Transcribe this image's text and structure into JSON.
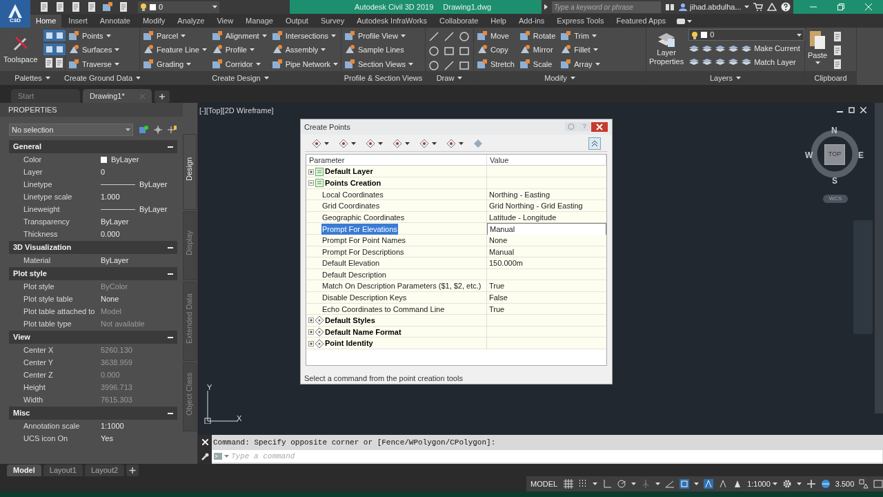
{
  "title_bar": {
    "layer": "0",
    "app_title": "Autodesk Civil 3D 2019",
    "file_name": "Drawing1.dwg",
    "search": {
      "placeholder": "Type a keyword or phrase"
    },
    "user": "jihad.abdulha..."
  },
  "app_button": {
    "label": "C3D"
  },
  "ribbon_tabs": [
    {
      "label": "Home",
      "selected": true
    },
    {
      "label": "Insert",
      "selected": false
    },
    {
      "label": "Annotate",
      "selected": false
    },
    {
      "label": "Modify",
      "selected": false
    },
    {
      "label": "Analyze",
      "selected": false
    },
    {
      "label": "View",
      "selected": false
    },
    {
      "label": "Manage",
      "selected": false
    },
    {
      "label": "Output",
      "selected": false
    },
    {
      "label": "Survey",
      "selected": false
    },
    {
      "label": "Autodesk InfraWorks",
      "selected": false
    },
    {
      "label": "Collaborate",
      "selected": false
    },
    {
      "label": "Help",
      "selected": false
    },
    {
      "label": "Add-ins",
      "selected": false
    },
    {
      "label": "Express Tools",
      "selected": false
    },
    {
      "label": "Featured Apps",
      "selected": false
    }
  ],
  "ribbon_panels": [
    {
      "kind": "palettes",
      "title": "Palettes",
      "dropdown": true,
      "big_button": "Toolspace"
    },
    {
      "kind": "columns",
      "title": "Create Ground Data",
      "dropdown": true,
      "columns": [
        [
          {
            "label": "Points",
            "dropdown": true
          },
          {
            "label": "Surfaces",
            "dropdown": true
          },
          {
            "label": "Traverse",
            "dropdown": true
          }
        ]
      ]
    },
    {
      "kind": "columns",
      "title": "Create Design",
      "dropdown": true,
      "columns": [
        [
          {
            "label": "Parcel",
            "dropdown": true
          },
          {
            "label": "Feature Line",
            "dropdown": true
          },
          {
            "label": "Grading",
            "dropdown": true
          }
        ],
        [
          {
            "label": "Alignment",
            "dropdown": true
          },
          {
            "label": "Profile",
            "dropdown": true
          },
          {
            "label": "Corridor",
            "dropdown": true
          }
        ],
        [
          {
            "label": "Intersections",
            "dropdown": true
          },
          {
            "label": "Assembly",
            "dropdown": true
          },
          {
            "label": "Pipe Network",
            "dropdown": true
          }
        ]
      ]
    },
    {
      "kind": "columns",
      "title": "Profile & Section Views",
      "dropdown": false,
      "columns": [
        [
          {
            "label": "Profile View",
            "dropdown": true
          },
          {
            "label": "Sample Lines",
            "dropdown": false
          },
          {
            "label": "Section Views",
            "dropdown": true
          }
        ]
      ]
    },
    {
      "kind": "icons",
      "title": "Draw",
      "dropdown": true
    },
    {
      "kind": "columns",
      "title": "Modify",
      "dropdown": true,
      "columns": [
        [
          {
            "label": "Move",
            "dropdown": false
          },
          {
            "label": "Copy",
            "dropdown": false
          },
          {
            "label": "Stretch",
            "dropdown": false
          }
        ],
        [
          {
            "label": "Rotate",
            "dropdown": false
          },
          {
            "label": "Mirror",
            "dropdown": false
          },
          {
            "label": "Scale",
            "dropdown": false
          }
        ],
        [
          {
            "label": "Trim",
            "dropdown": true
          },
          {
            "label": "Fillet",
            "dropdown": true
          },
          {
            "label": "Array",
            "dropdown": true
          }
        ]
      ]
    },
    {
      "kind": "layers",
      "title": "Layers",
      "dropdown": true,
      "big_button": "Layer Properties",
      "layer": "0",
      "items": [
        {
          "label": "Make Current"
        },
        {
          "label": "Match Layer"
        }
      ]
    },
    {
      "kind": "clipboard",
      "title": "Clipboard",
      "dropdown": false,
      "big_button": "Paste"
    }
  ],
  "document_tabs": [
    {
      "label": "Start",
      "selected": false
    },
    {
      "label": "Drawing1*",
      "selected": true
    }
  ],
  "properties": {
    "title": "PROPERTIES",
    "selection": "No selection",
    "sections": [
      {
        "title": "General",
        "expanded": true,
        "rows": [
          {
            "kind": "color",
            "label": "Color",
            "value": "ByLayer",
            "disabled": false
          },
          {
            "kind": "text",
            "label": "Layer",
            "value": "0",
            "disabled": false
          },
          {
            "kind": "line",
            "label": "Linetype",
            "value": "ByLayer",
            "disabled": false
          },
          {
            "kind": "text",
            "label": "Linetype scale",
            "value": "1.000",
            "disabled": false
          },
          {
            "kind": "line",
            "label": "Lineweight",
            "value": "ByLayer",
            "disabled": false
          },
          {
            "kind": "text",
            "label": "Transparency",
            "value": "ByLayer",
            "disabled": false
          },
          {
            "kind": "text",
            "label": "Thickness",
            "value": "0.000",
            "disabled": false
          }
        ]
      },
      {
        "title": "3D Visualization",
        "expanded": true,
        "rows": [
          {
            "kind": "text",
            "label": "Material",
            "value": "ByLayer",
            "disabled": false
          }
        ]
      },
      {
        "title": "Plot style",
        "expanded": true,
        "rows": [
          {
            "kind": "text",
            "label": "Plot style",
            "value": "ByColor",
            "disabled": true
          },
          {
            "kind": "text",
            "label": "Plot style table",
            "value": "None",
            "disabled": false
          },
          {
            "kind": "text",
            "label": "Plot table attached to",
            "value": "Model",
            "disabled": true
          },
          {
            "kind": "text",
            "label": "Plot table type",
            "value": "Not available",
            "disabled": true
          }
        ]
      },
      {
        "title": "View",
        "expanded": true,
        "rows": [
          {
            "kind": "text",
            "label": "Center X",
            "value": "5260.130",
            "disabled": true
          },
          {
            "kind": "text",
            "label": "Center Y",
            "value": "3638.959",
            "disabled": true
          },
          {
            "kind": "text",
            "label": "Center Z",
            "value": "0.000",
            "disabled": true
          },
          {
            "kind": "text",
            "label": "Height",
            "value": "3996.713",
            "disabled": true
          },
          {
            "kind": "text",
            "label": "Width",
            "value": "7615.303",
            "disabled": true
          }
        ]
      },
      {
        "title": "Misc",
        "expanded": true,
        "rows": [
          {
            "kind": "text",
            "label": "Annotation scale",
            "value": "1:1000",
            "disabled": false
          },
          {
            "kind": "text",
            "label": "UCS icon On",
            "value": "Yes",
            "disabled": false
          }
        ]
      }
    ],
    "side_tabs": [
      {
        "label": "Design",
        "selected": true
      },
      {
        "label": "Display",
        "selected": false
      },
      {
        "label": "Extended Data",
        "selected": false
      },
      {
        "label": "Object Class",
        "selected": false
      }
    ]
  },
  "viewport": {
    "label": "[-][Top][2D Wireframe]",
    "viewcube": {
      "north": "N",
      "south": "S",
      "west": "W",
      "east": "E",
      "face": "TOP",
      "ucs": "WCS"
    },
    "ucs_icon": {
      "y": "Y",
      "x": "X"
    }
  },
  "dialog": {
    "title": "Create Points",
    "columns": [
      "Parameter",
      "Value"
    ],
    "rows": [
      {
        "kind": "group",
        "label": "Default Layer",
        "expanded": false
      },
      {
        "kind": "group",
        "label": "Points Creation",
        "expanded": true,
        "children": [
          {
            "label": "Local Coordinates",
            "value": "Northing - Easting",
            "selected": false
          },
          {
            "label": "Grid Coordinates",
            "value": "Grid Northing - Grid Easting",
            "selected": false
          },
          {
            "label": "Geographic Coordinates",
            "value": "Latitude - Longitude",
            "selected": false
          },
          {
            "label": "Prompt For Elevations",
            "value": "Manual",
            "selected": true
          },
          {
            "label": "Prompt For Point Names",
            "value": "None",
            "selected": false
          },
          {
            "label": "Prompt For Descriptions",
            "value": "Manual",
            "selected": false
          },
          {
            "label": "Default Elevation",
            "value": "150.000m",
            "selected": false
          },
          {
            "label": "Default Description",
            "selected": false
          },
          {
            "label": "Match On Description Parameters ($1, $2, etc.)",
            "value": "True",
            "selected": false
          },
          {
            "label": "Disable Description Keys",
            "value": "False",
            "selected": false
          },
          {
            "label": "Echo Coordinates to Command Line",
            "value": "True",
            "selected": false
          }
        ]
      },
      {
        "kind": "style",
        "label": "Default Styles",
        "expanded": false
      },
      {
        "kind": "style",
        "label": "Default Name Format",
        "expanded": false
      },
      {
        "kind": "style",
        "label": "Point Identity",
        "expanded": false
      }
    ],
    "status": "Select a command from the point creation tools"
  },
  "command_line": {
    "history": "Command: Specify opposite corner or [Fence/WPolygon/CPolygon]:",
    "input": {
      "placeholder": "Type a command"
    }
  },
  "layout_tabs": [
    {
      "label": "Model",
      "selected": true
    },
    {
      "label": "Layout1",
      "selected": false
    },
    {
      "label": "Layout2",
      "selected": false
    }
  ],
  "status_bar": {
    "model": "MODEL",
    "scale": "1:1000",
    "lineweight": "3.500"
  }
}
